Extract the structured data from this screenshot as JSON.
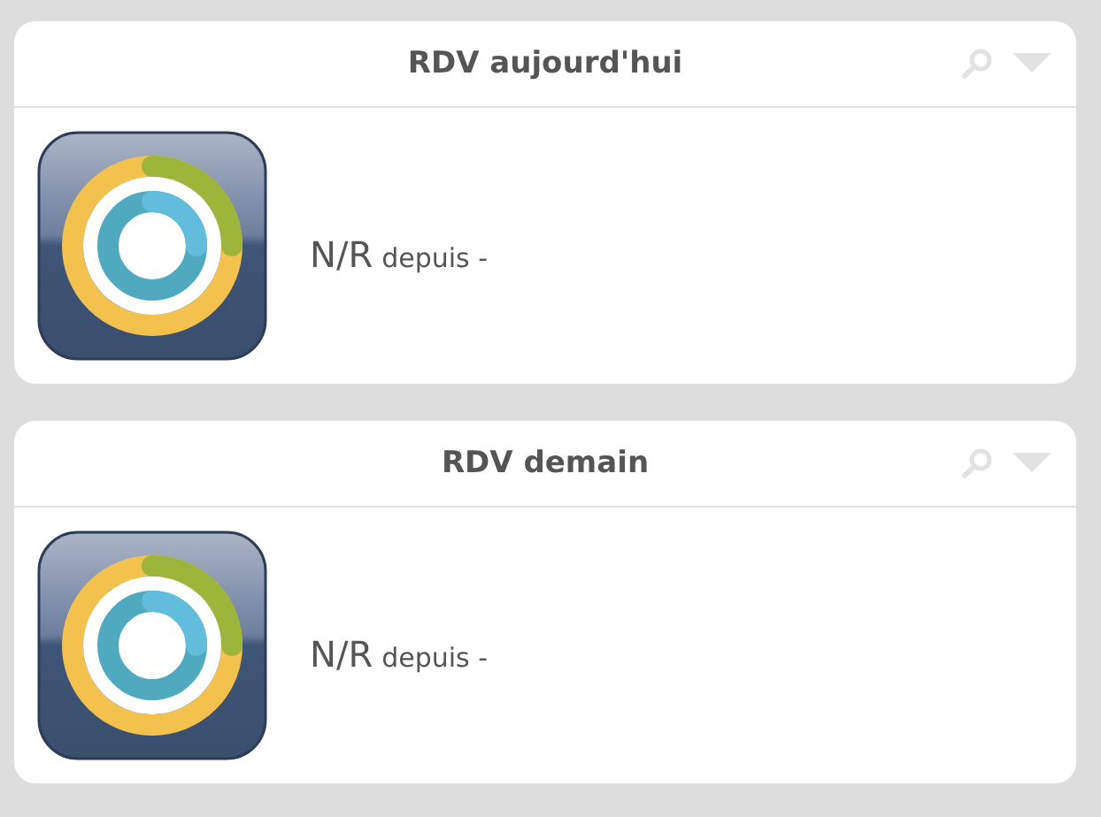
{
  "widgets": [
    {
      "title": "RDV aujourd'hui",
      "status": "N/R",
      "since": "depuis -"
    },
    {
      "title": "RDV demain",
      "status": "N/R",
      "since": "depuis -"
    }
  ]
}
